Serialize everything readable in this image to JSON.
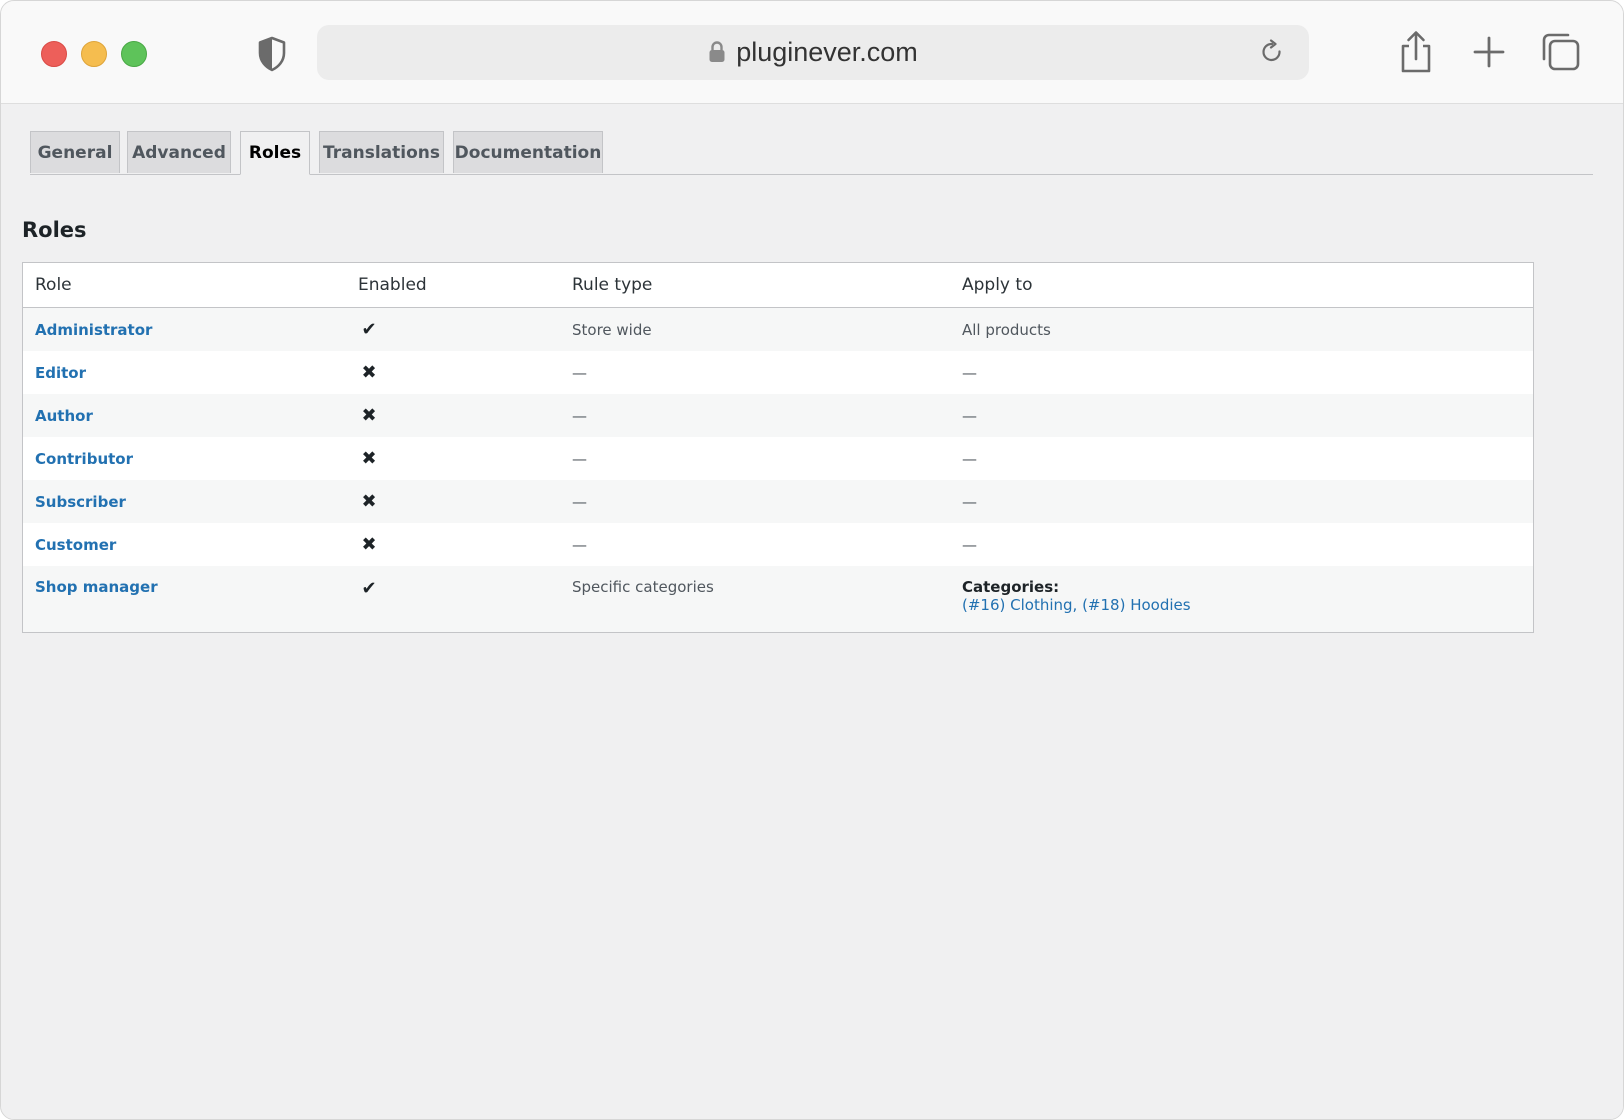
{
  "browser": {
    "url": "pluginever.com"
  },
  "tabs": [
    {
      "label": "General",
      "active": false
    },
    {
      "label": "Advanced",
      "active": false
    },
    {
      "label": "Roles",
      "active": true
    },
    {
      "label": "Translations",
      "active": false
    },
    {
      "label": "Documentation",
      "active": false
    }
  ],
  "section": {
    "title": "Roles"
  },
  "table": {
    "headers": {
      "role": "Role",
      "enabled": "Enabled",
      "rule_type": "Rule type",
      "apply_to": "Apply to"
    },
    "rows": [
      {
        "role": "Administrator",
        "enabled": "✔",
        "rule_type": "Store wide",
        "apply_to": "All products"
      },
      {
        "role": "Editor",
        "enabled": "✖",
        "rule_type": "—",
        "apply_to": "—"
      },
      {
        "role": "Author",
        "enabled": "✖",
        "rule_type": "—",
        "apply_to": "—"
      },
      {
        "role": "Contributor",
        "enabled": "✖",
        "rule_type": "—",
        "apply_to": "—"
      },
      {
        "role": "Subscriber",
        "enabled": "✖",
        "rule_type": "—",
        "apply_to": "—"
      },
      {
        "role": "Customer",
        "enabled": "✖",
        "rule_type": "—",
        "apply_to": "—"
      },
      {
        "role": "Shop manager",
        "enabled": "✔",
        "rule_type": "Specific categories",
        "apply_to_label": "Categories:",
        "categories": [
          "(#16) Clothing",
          "(#18) Hoodies"
        ],
        "category_separator": ", "
      }
    ]
  },
  "colors": {
    "link": "#2271b1",
    "page_bg": "#f0f0f1",
    "border": "#c3c4c7"
  }
}
